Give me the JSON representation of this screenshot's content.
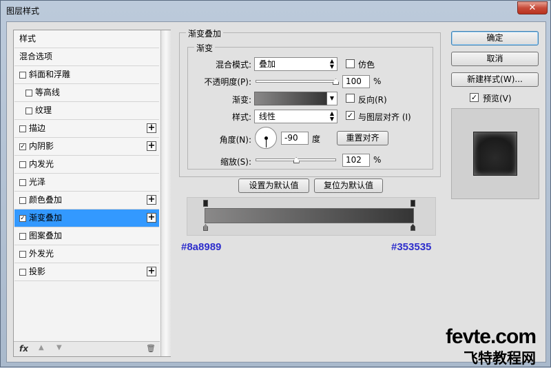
{
  "window": {
    "title": "图层样式",
    "close_glyph": "✕"
  },
  "sidebar": {
    "items": [
      {
        "label": "样式",
        "checkbox": false,
        "checked": false,
        "indent": 0,
        "plus": false,
        "selected": false
      },
      {
        "label": "混合选项",
        "checkbox": false,
        "checked": false,
        "indent": 0,
        "plus": false,
        "selected": false
      },
      {
        "label": "斜面和浮雕",
        "checkbox": true,
        "checked": false,
        "indent": 0,
        "plus": false,
        "selected": false
      },
      {
        "label": "等高线",
        "checkbox": true,
        "checked": false,
        "indent": 1,
        "plus": false,
        "selected": false
      },
      {
        "label": "纹理",
        "checkbox": true,
        "checked": false,
        "indent": 1,
        "plus": false,
        "selected": false
      },
      {
        "label": "描边",
        "checkbox": true,
        "checked": false,
        "indent": 0,
        "plus": true,
        "selected": false
      },
      {
        "label": "内阴影",
        "checkbox": true,
        "checked": true,
        "indent": 0,
        "plus": true,
        "selected": false
      },
      {
        "label": "内发光",
        "checkbox": true,
        "checked": false,
        "indent": 0,
        "plus": false,
        "selected": false
      },
      {
        "label": "光泽",
        "checkbox": true,
        "checked": false,
        "indent": 0,
        "plus": false,
        "selected": false
      },
      {
        "label": "颜色叠加",
        "checkbox": true,
        "checked": false,
        "indent": 0,
        "plus": true,
        "selected": false
      },
      {
        "label": "渐变叠加",
        "checkbox": true,
        "checked": true,
        "indent": 0,
        "plus": true,
        "selected": true
      },
      {
        "label": "图案叠加",
        "checkbox": true,
        "checked": false,
        "indent": 0,
        "plus": false,
        "selected": false
      },
      {
        "label": "外发光",
        "checkbox": true,
        "checked": false,
        "indent": 0,
        "plus": false,
        "selected": false
      },
      {
        "label": "投影",
        "checkbox": true,
        "checked": false,
        "indent": 0,
        "plus": true,
        "selected": false
      }
    ],
    "bottom": {
      "fx": "fx",
      "up": "▲",
      "down": "▼",
      "trash": "🗑"
    }
  },
  "panel": {
    "group_title": "渐变叠加",
    "sub_title": "渐变",
    "blend_mode_label": "混合模式:",
    "blend_mode_value": "叠加",
    "dither_label": "仿色",
    "dither_checked": false,
    "opacity_label": "不透明度(P):",
    "opacity_value": "100",
    "opacity_unit": "%",
    "opacity_fraction": 1.0,
    "gradient_label": "渐变:",
    "reverse_label": "反向(R)",
    "reverse_checked": false,
    "style_label": "样式:",
    "style_value": "线性",
    "align_label": "与图层对齐 (I)",
    "align_checked": true,
    "angle_label": "角度(N):",
    "angle_value": "-90",
    "angle_unit": "度",
    "reset_align_label": "重置对齐",
    "scale_label": "缩放(S):",
    "scale_value": "102",
    "scale_unit": "%",
    "scale_fraction": 0.51,
    "set_default_label": "设置为默认值",
    "reset_default_label": "复位为默认值"
  },
  "gradient_editor": {
    "start_color": "#8a8989",
    "end_color": "#353535",
    "start_hex_label": "#8a8989",
    "end_hex_label": "#353535"
  },
  "actions": {
    "ok_label": "确定",
    "cancel_label": "取消",
    "new_style_label": "新建样式(W)...",
    "preview_label": "预览(V)",
    "preview_checked": true
  },
  "watermark": {
    "line1": "fevte.com",
    "line2": "飞特教程网"
  }
}
